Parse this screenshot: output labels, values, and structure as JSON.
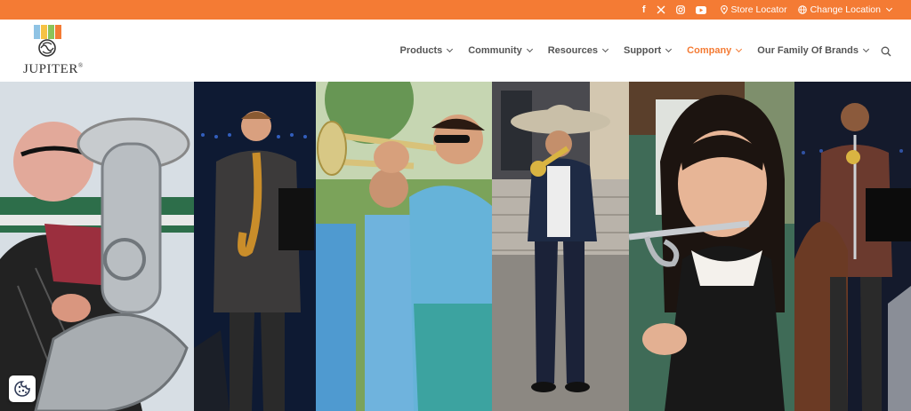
{
  "topbar": {
    "background": "#f47b34",
    "social": [
      {
        "name": "facebook",
        "glyph": "f"
      },
      {
        "name": "x-twitter",
        "glyph": "𝕏"
      },
      {
        "name": "instagram",
        "glyph": "◎"
      },
      {
        "name": "youtube",
        "glyph": "▶"
      }
    ],
    "store_locator": "Store Locator",
    "change_location": "Change Location"
  },
  "logo": {
    "text": "JUPITER",
    "registered": "®"
  },
  "nav": {
    "items": [
      {
        "label": "Products",
        "active": false
      },
      {
        "label": "Community",
        "active": false
      },
      {
        "label": "Resources",
        "active": false
      },
      {
        "label": "Support",
        "active": false
      },
      {
        "label": "Company",
        "active": true
      },
      {
        "label": "Our Family Of Brands",
        "active": false
      }
    ],
    "accent": "#f47b34"
  },
  "hero": {
    "panels": [
      {
        "name": "euphonium-player"
      },
      {
        "name": "saxophone-player"
      },
      {
        "name": "trumpet-player-sunglasses"
      },
      {
        "name": "mariachi-trumpet-player"
      },
      {
        "name": "young-flute-player"
      },
      {
        "name": "trumpet-player-stage"
      }
    ]
  },
  "cookie": {
    "icon": "cookie-icon"
  }
}
